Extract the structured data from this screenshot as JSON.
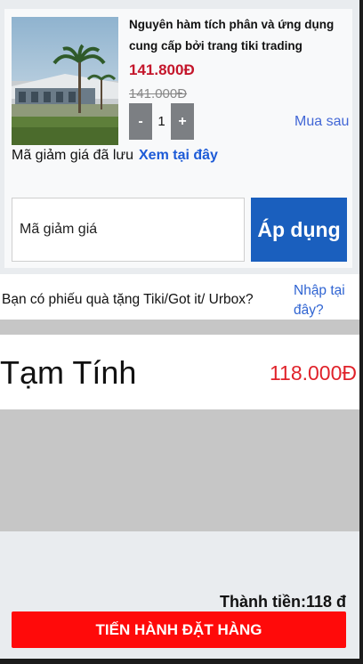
{
  "product": {
    "name": "Nguyên hàm tích phân và ứng dụng cung cấp bởi trang tiki trading",
    "price": "141.800Đ",
    "original_price": "141.000Đ",
    "quantity": "1",
    "minus_label": "-",
    "plus_label": "+",
    "buy_later_label": "Mua sau",
    "image_icon": "product-photo-icon"
  },
  "coupon": {
    "saved_text": "Mã giảm giá đã lưu",
    "saved_link": "Xem tại đây",
    "input_placeholder": "Mã giảm giá",
    "apply_label": "Áp dụng"
  },
  "gift": {
    "question": "Bạn có phiếu quà tặng Tiki/Got it/ Urbox?",
    "link": "Nhập tại đây?"
  },
  "summary": {
    "subtotal_label": "Tạm Tính",
    "subtotal_value": "118.000Đ",
    "grand_total": "Thành tiền:118 đ",
    "checkout_label": "TIẾN HÀNH ĐẶT HÀNG"
  },
  "colors": {
    "price": "#c4162b",
    "apply_button": "#1a5fbe",
    "checkout_button": "#ff0a0a",
    "link": "#2f64d2"
  }
}
